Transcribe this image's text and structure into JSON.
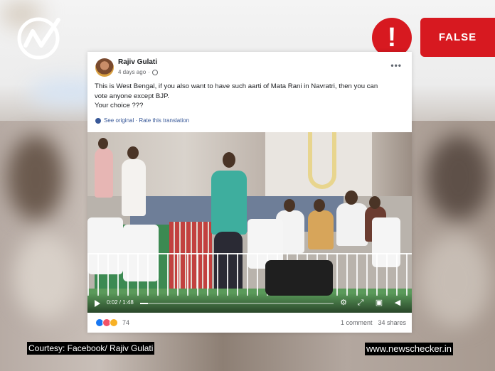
{
  "verdict": {
    "icon_glyph": "!",
    "label": "FALSE",
    "color": "#d71920"
  },
  "post": {
    "author": "Rajiv Gulati",
    "time": "4 days ago",
    "privacy_icon": "globe-icon",
    "more_icon": "•••",
    "text_lines": [
      "This is West Bengal, if you also want to have such aarti of Mata Rani in Navratri, then you can",
      "vote anyone except BJP.",
      "Your choice ???"
    ],
    "see_original": "See original",
    "separator": " · ",
    "rate_translation": "Rate this translation"
  },
  "video": {
    "time_display": "0:02 / 1:48",
    "progress": 0.02
  },
  "footer": {
    "reaction_count": "74",
    "comments": "1 comment",
    "shares": "34 shares"
  },
  "captions": {
    "courtesy": "Courtesy: Facebook/ Rajiv Gulati",
    "site": "www.newschecker.in"
  }
}
